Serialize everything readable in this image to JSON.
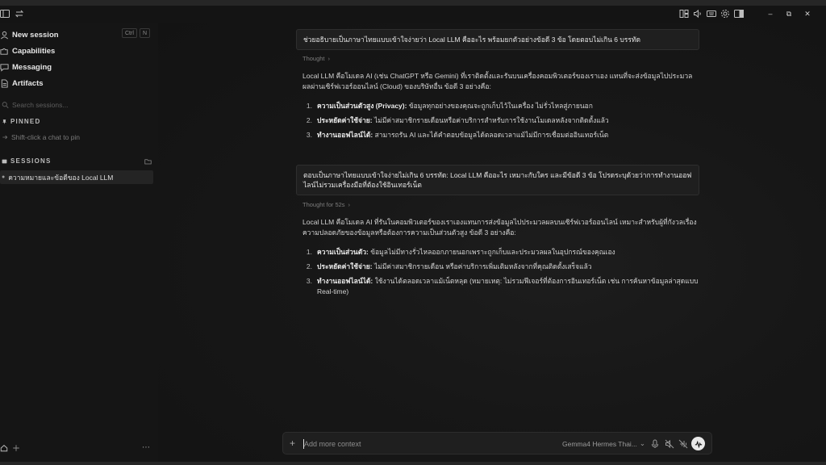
{
  "titlebar": {
    "left_icons": [
      "sidebar-toggle-icon",
      "swap-icon"
    ],
    "right_icons": [
      "layout-icon",
      "volume-icon",
      "keyboard-icon",
      "settings-icon",
      "panel-icon"
    ],
    "window_controls": {
      "minimize": "‒",
      "maximize": "⧉",
      "close": "✕"
    }
  },
  "sidebar": {
    "new_session": {
      "label": "New session",
      "shortcut_ctrl": "Ctrl",
      "shortcut_key": "N"
    },
    "nav": [
      {
        "label": "Capabilities",
        "icon": "puzzle-icon"
      },
      {
        "label": "Messaging",
        "icon": "chat-bubble-icon"
      },
      {
        "label": "Artifacts",
        "icon": "document-icon"
      }
    ],
    "search_placeholder": "Search sessions...",
    "pinned": {
      "title": "PINNED",
      "hint": "Shift-click a chat to pin"
    },
    "sessions": {
      "title": "SESSIONS",
      "items": [
        "ความหมายและข้อดีของ Local LLM"
      ]
    },
    "footer_more": "⋯"
  },
  "conversation": {
    "q1": "ช่วยอธิบายเป็นภาษาไทยแบบเข้าใจง่ายว่า Local LLM คืออะไร พร้อมยกตัวอย่างข้อดี 3 ข้อ โดยตอบไม่เกิน 6 บรรทัด",
    "t1": "Thought",
    "a1_intro": "Local LLM คือโมเดล AI (เช่น ChatGPT หรือ Gemini) ที่เราติดตั้งและรันบนเครื่องคอมพิวเตอร์ของเราเอง แทนที่จะส่งข้อมูลไปประมวลผลผ่านเซิร์ฟเวอร์ออนไลน์ (Cloud) ของบริษัทอื่น ข้อดี 3 อย่างคือ:",
    "a1_items": [
      {
        "num": "1.",
        "bold": "ความเป็นส่วนตัวสูง (Privacy):",
        "text": " ข้อมูลทุกอย่างของคุณจะถูกเก็บไว้ในเครื่อง ไม่รั่วไหลสู่ภายนอก"
      },
      {
        "num": "2.",
        "bold": "ประหยัดค่าใช้จ่าย:",
        "text": " ไม่มีค่าสมาชิกรายเดือนหรือค่าบริการสำหรับการใช้งานโมเดลหลังจากติดตั้งแล้ว"
      },
      {
        "num": "3.",
        "bold": "ทำงานออฟไลน์ได้:",
        "text": " สามารถรัน AI และได้คำตอบข้อมูลได้ตลอดเวลาแม้ไม่มีการเชื่อมต่ออินเทอร์เน็ต"
      }
    ],
    "q2": "ตอบเป็นภาษาไทยแบบเข้าใจง่ายไม่เกิน 6 บรรทัด: Local LLM คืออะไร เหมาะกับใคร และมีข้อดี 3 ข้อ โปรดระบุด้วยว่าการทำงานออฟไลน์ไม่รวมเครื่องมือที่ต้องใช้อินเทอร์เน็ต",
    "t2": "Thought for 52s",
    "a2_intro": "Local LLM คือโมเดล AI ที่รันในคอมพิวเตอร์ของเราเองแทนการส่งข้อมูลไปประมวลผลบนเซิร์ฟเวอร์ออนไลน์ เหมาะสำหรับผู้ที่กังวลเรื่องความปลอดภัยของข้อมูลหรือต้องการความเป็นส่วนตัวสูง ข้อดี 3 อย่างคือ:",
    "a2_items": [
      {
        "num": "1.",
        "bold": "ความเป็นส่วนตัว:",
        "text": " ข้อมูลไม่มีทางรั่วไหลออกภายนอกเพราะถูกเก็บและประมวลผลในอุปกรณ์ของคุณเอง"
      },
      {
        "num": "2.",
        "bold": "ประหยัดค่าใช้จ่าย:",
        "text": " ไม่มีค่าสมาชิกรายเดือน หรือค่าบริการเพิ่มเติมหลังจากที่คุณติดตั้งเสร็จแล้ว"
      },
      {
        "num": "3.",
        "bold": "ทำงานออฟไลน์ได้:",
        "text": " ใช้งานได้ตลอดเวลาแม้เน็ตหลุด (หมายเหตุ: ไม่รวมฟีเจอร์ที่ต้องการอินเทอร์เน็ต เช่น การค้นหาข้อมูลล่าสุดแบบ Real-time)"
      }
    ]
  },
  "composer": {
    "plus": "+",
    "placeholder": "Add more context",
    "model": "Gemma4 Hermes Thai...",
    "icons": [
      "microphone-icon",
      "mute-icon",
      "voice-off-icon",
      "voice-wave-icon"
    ]
  }
}
